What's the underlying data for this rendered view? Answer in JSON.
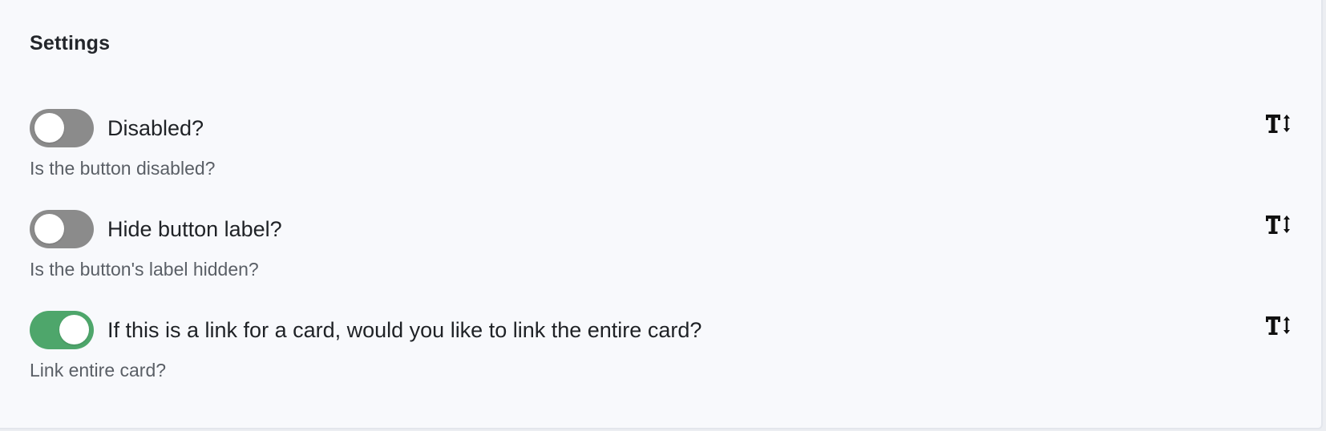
{
  "settings_panel": {
    "title": "Settings",
    "items": [
      {
        "label": "Disabled?",
        "help": "Is the button disabled?",
        "enabled": false,
        "icon": "text-size-icon"
      },
      {
        "label": "Hide button label?",
        "help": "Is the button's label hidden?",
        "enabled": false,
        "icon": "text-size-icon"
      },
      {
        "label": "If this is a link for a card, would you like to link the entire card?",
        "help": "Link entire card?",
        "enabled": true,
        "icon": "text-size-icon"
      }
    ]
  },
  "colors": {
    "toggle_off": "#8b8b8b",
    "toggle_on": "#4ea66b",
    "panel_background": "#f8f9fc"
  }
}
